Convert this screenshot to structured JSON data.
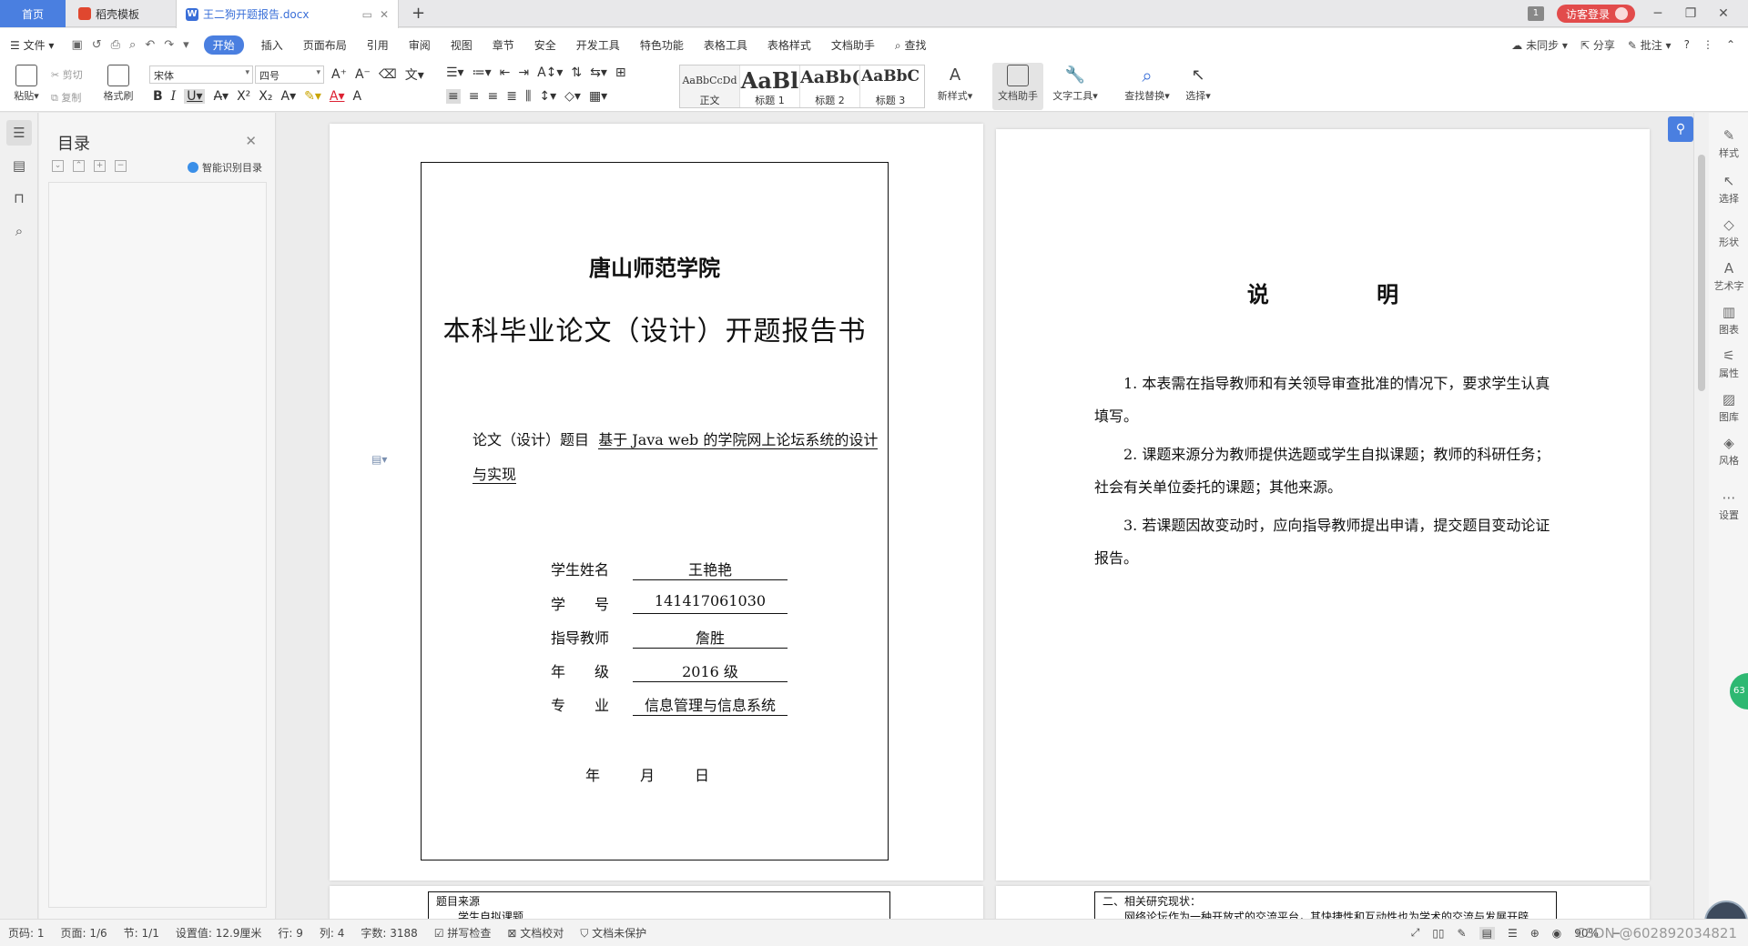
{
  "tabs": {
    "home": "首页",
    "template": "稻壳模板",
    "doc": "王二狗开题报告.docx",
    "notification_count": "1",
    "login": "访客登录"
  },
  "menu": {
    "file": "文件",
    "items": [
      "开始",
      "插入",
      "页面布局",
      "引用",
      "审阅",
      "视图",
      "章节",
      "安全",
      "开发工具",
      "特色功能",
      "表格工具",
      "表格样式",
      "文档助手"
    ],
    "search": "查找",
    "sync": "未同步",
    "share": "分享",
    "comment": "批注"
  },
  "ribbon": {
    "paste": "粘贴",
    "cut": "剪切",
    "copy": "复制",
    "format_painter": "格式刷",
    "font_name": "宋体",
    "font_size": "四号",
    "styles": [
      {
        "preview": "AaBbCcDd",
        "name": "正文"
      },
      {
        "preview": "AaBl",
        "name": "标题 1"
      },
      {
        "preview": "AaBb(",
        "name": "标题 2"
      },
      {
        "preview": "AaBbC",
        "name": "标题 3"
      }
    ],
    "new_style": "新样式",
    "doc_assistant": "文档助手",
    "text_tools": "文字工具",
    "find_replace": "查找替换",
    "select": "选择"
  },
  "toc": {
    "title": "目录",
    "smart": "智能识别目录"
  },
  "page1": {
    "university": "唐山师范学院",
    "title": "本科毕业论文（设计）开题报告书",
    "topic_label": "论文（设计）题目",
    "topic_line1": "基于 Java web 的学院网上论坛系统的设计",
    "topic_line2": "与实现",
    "fields": [
      {
        "label": "学生姓名",
        "value": "王艳艳"
      },
      {
        "label": "学　　号",
        "value": "141417061030"
      },
      {
        "label": "指导教师",
        "value": "詹胜"
      },
      {
        "label": "年　　级",
        "value": "2016 级"
      },
      {
        "label": "专　　业",
        "value": "信息管理与信息系统"
      }
    ],
    "date": [
      "年",
      "月",
      "日"
    ]
  },
  "page2": {
    "title": "说 明",
    "items": [
      "1. 本表需在指导教师和有关领导审查批准的情况下，要求学生认真填写。",
      "2. 课题来源分为教师提供选题或学生自拟课题；教师的科研任务；社会有关单位委托的课题；其他来源。",
      "3. 若课题因故变动时，应向指导教师提出申请，提交题目变动论证报告。"
    ]
  },
  "next_pages": {
    "left_line1": "题目来源",
    "left_line2": "学生自拟课题",
    "right_line1": "二、相关研究现状：",
    "right_line2": "网络论坛作为一种开放式的交流平台，其快捷性和互动性也为学术的交流与发展开辟"
  },
  "rightbar": {
    "tools": [
      "样式",
      "选择",
      "形状",
      "艺术字",
      "图表",
      "属性",
      "图库",
      "风格",
      "设置"
    ]
  },
  "status": {
    "page_code": "页码: 1",
    "page": "页面: 1/6",
    "section": "节: 1/1",
    "setting": "设置值: 12.9厘米",
    "row": "行: 9",
    "col": "列: 4",
    "words": "字数: 3188",
    "spell": "拼写检查",
    "proof": "文档校对",
    "protect": "文档未保护",
    "zoom": "90%",
    "watermark": "CSDN @602892034821"
  }
}
